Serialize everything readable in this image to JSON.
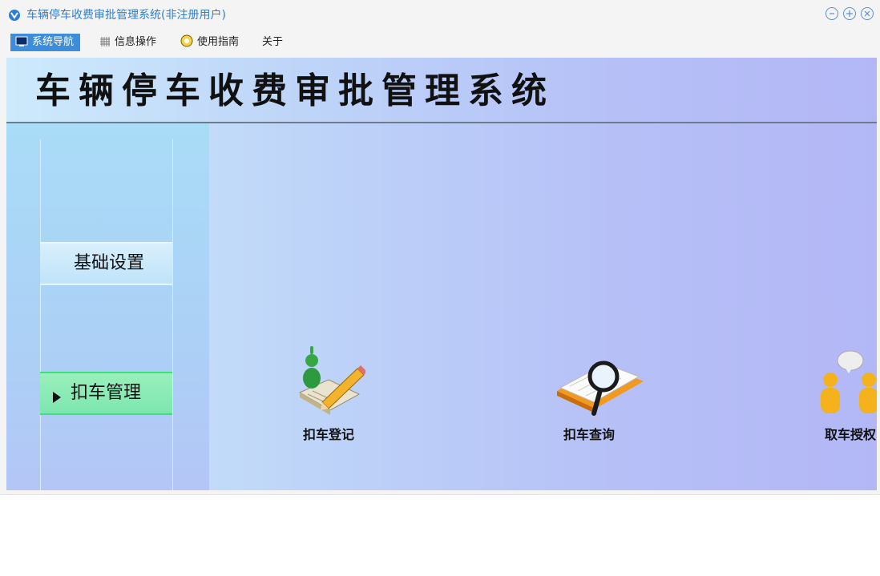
{
  "window": {
    "title": "车辆停车收费审批管理系统(非注册用户)",
    "controls": [
      "minimize-icon",
      "maximize-icon",
      "close-icon"
    ]
  },
  "menu": {
    "items": [
      {
        "label": "系统导航",
        "icon": "monitor-icon",
        "active": true
      },
      {
        "label": "信息操作",
        "icon": "grid-icon",
        "active": false
      },
      {
        "label": "使用指南",
        "icon": "guide-icon",
        "active": false
      },
      {
        "label": "关于",
        "icon": "",
        "active": false
      }
    ]
  },
  "banner": {
    "title": "车辆停车收费审批管理系统"
  },
  "sidebar": {
    "items": [
      {
        "label": "基础设置",
        "active": false
      },
      {
        "label": "扣车管理",
        "active": true
      }
    ]
  },
  "main": {
    "tiles": [
      {
        "label": "扣车登记",
        "icon": "registration-edit-icon"
      },
      {
        "label": "扣车查询",
        "icon": "magnifier-search-icon"
      },
      {
        "label": "取车授权",
        "icon": "people-authorization-icon"
      }
    ]
  },
  "colors": {
    "accent": "#3d8ddb",
    "title_text": "#2e7fd3",
    "active_sidebar": "#8fecb8"
  }
}
